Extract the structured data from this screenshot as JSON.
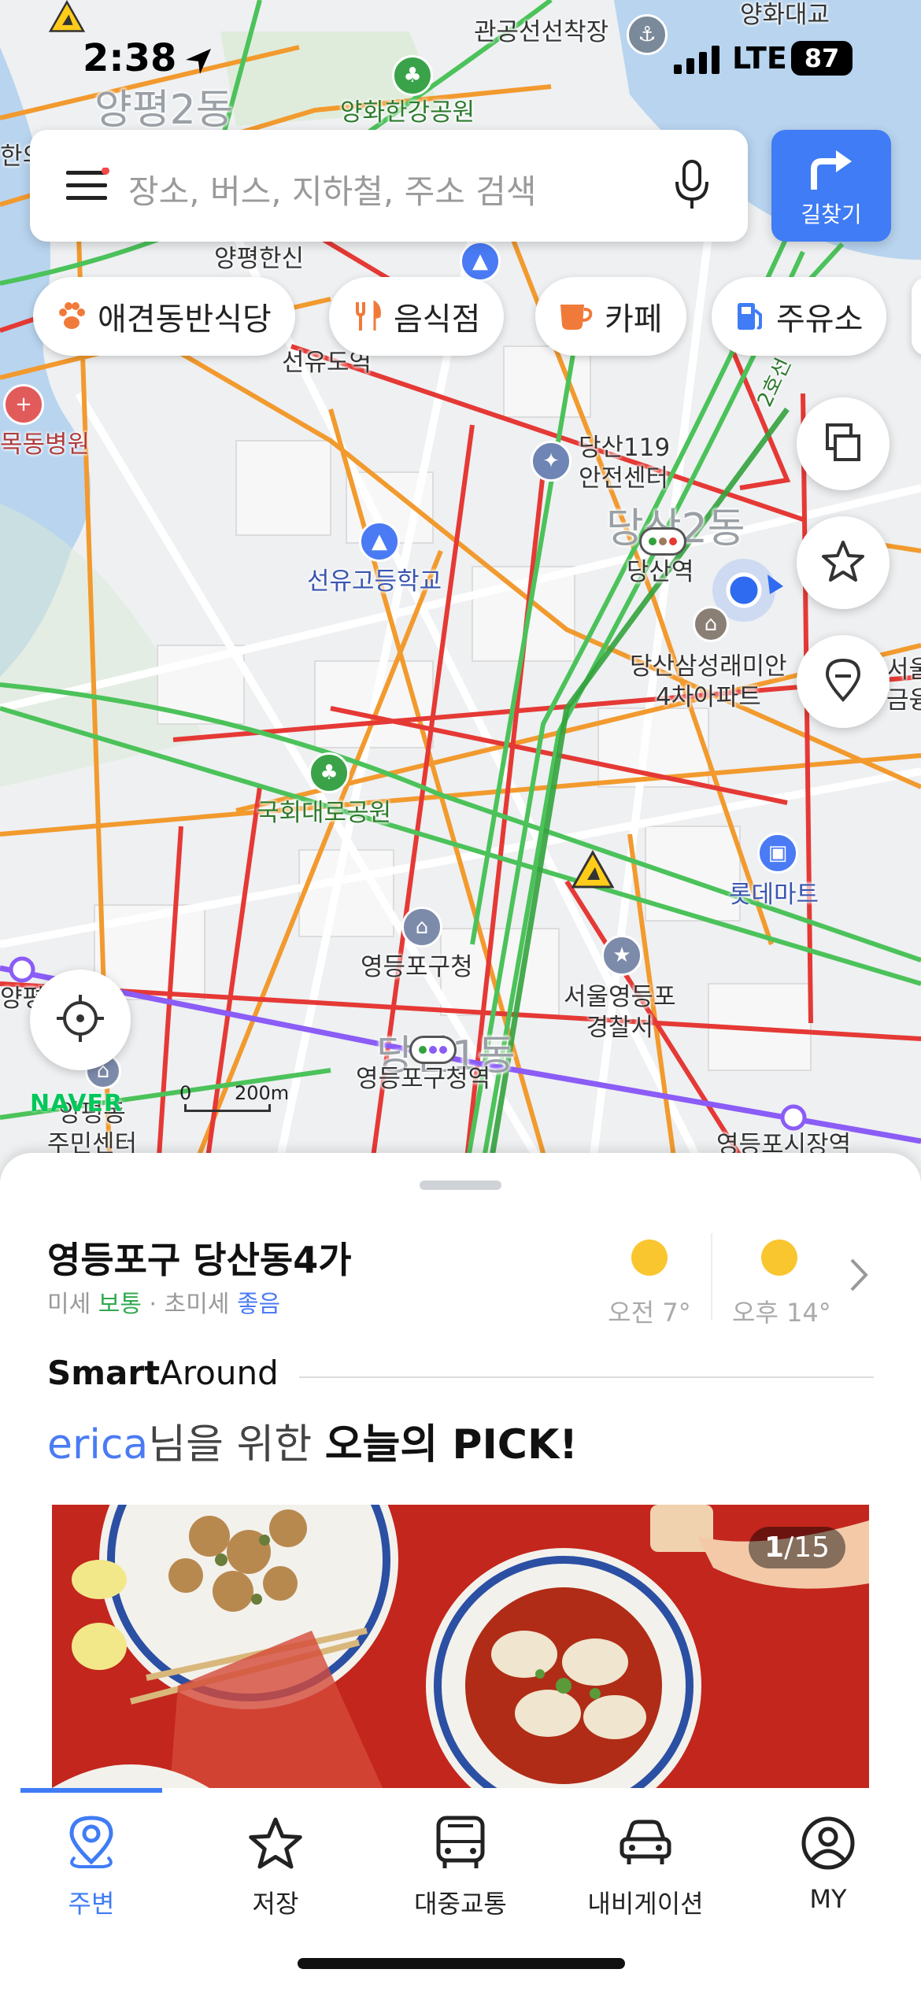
{
  "status_bar": {
    "time": "2:38",
    "network": "LTE",
    "battery": "87"
  },
  "search": {
    "placeholder": "장소, 버스, 지하철, 주소 검색",
    "directions_label": "길찾기"
  },
  "chips": [
    {
      "label": "애견동반식당",
      "icon": "paw-icon",
      "color": "#f07a3a"
    },
    {
      "label": "음식점",
      "icon": "fork-knife-icon",
      "color": "#f07a3a"
    },
    {
      "label": "카페",
      "icon": "coffee-cup-icon",
      "color": "#f07a3a"
    },
    {
      "label": "주유소",
      "icon": "gas-pump-icon",
      "color": "#3f7cf5"
    }
  ],
  "map": {
    "labels": {
      "gwangong": "관공선선착장",
      "yanghwa_bridge": "양화대교",
      "yanghwa_park": "양화한강공원",
      "yangpyeong2": "양평2동",
      "yangpyeong_hansin": "양평한신",
      "seonyudo": "선유도역",
      "mokdong_hospital": "목동병원",
      "dangsan119_1": "당산119",
      "dangsan119_2": "안전센터",
      "dangsan2dong": "당산2동",
      "dangsan_station": "당산역",
      "seonyu_high": "선유고등학교",
      "samsung_1": "당산삼성래미안",
      "samsung_2": "4차아파트",
      "gukhoe_park": "국회대로공원",
      "lotte_mart": "롯데마트",
      "ydp_office": "영등포구청",
      "police_1": "서울영등포",
      "police_2": "경찰서",
      "ydp_office_station": "영등포구청역",
      "ydp_market": "영등포시장역",
      "dangsan1dong": "당산1동",
      "center_1": "양평동",
      "center_2": "주민센터",
      "road_2ho": "2호선",
      "cut_yangpyeong": "양평",
      "cut_left": "한의",
      "cut_right_1": "서울",
      "cut_right_2": "금융"
    },
    "naver_logo": "NAVER",
    "scale_zero": "0",
    "scale_label": "200m",
    "colors": {
      "congested": "#e53935",
      "slow": "#f29a2e",
      "smooth": "#4cc25a",
      "subway2": "#33a23d",
      "subway5": "#8b5cf6"
    }
  },
  "sheet": {
    "place": "영등포구 당산동4가",
    "dust_label": "미세",
    "dust_value": "보통",
    "sep": "·",
    "fine_dust_label": "초미세",
    "fine_dust_value": "좋음",
    "weather": [
      {
        "time": "오전",
        "temp": "7°",
        "icon": "sun-icon"
      },
      {
        "time": "오후",
        "temp": "14°",
        "icon": "sun-icon"
      }
    ],
    "smart_bold": "Smart",
    "smart_rest": "Around",
    "pick_user": "erica",
    "pick_mid": "님을 위한 ",
    "pick_strong": "오늘의 PICK!",
    "card_current": "1",
    "card_total": "/15"
  },
  "tabs": [
    {
      "label": "주변",
      "icon": "location-pin-icon",
      "active": true
    },
    {
      "label": "저장",
      "icon": "star-icon",
      "active": false
    },
    {
      "label": "대중교통",
      "icon": "bus-icon",
      "active": false
    },
    {
      "label": "내비게이션",
      "icon": "car-icon",
      "active": false
    },
    {
      "label": "MY",
      "icon": "profile-icon",
      "active": false
    }
  ]
}
